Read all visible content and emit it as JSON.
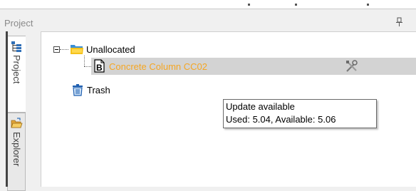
{
  "panel": {
    "title": "Project",
    "pin_icon": "pin-icon"
  },
  "side_tabs": [
    {
      "label": "Project",
      "icon": "project-tree-icon",
      "active": true
    },
    {
      "label": "Explorer",
      "icon": "folder-open-icon",
      "active": false
    }
  ],
  "tree": {
    "root": {
      "label": "Unallocated",
      "icon": "folder-icon",
      "expanded": true
    },
    "child": {
      "label": "Concrete Column CC02",
      "icon": "document-icon",
      "status_icon": "tools-icon",
      "label_color": "#f5a623",
      "selected": true
    },
    "trash": {
      "label": "Trash",
      "icon": "trash-icon"
    }
  },
  "tooltip": {
    "line1": "Update available",
    "line2": "Used: 5.04, Available: 5.06"
  }
}
